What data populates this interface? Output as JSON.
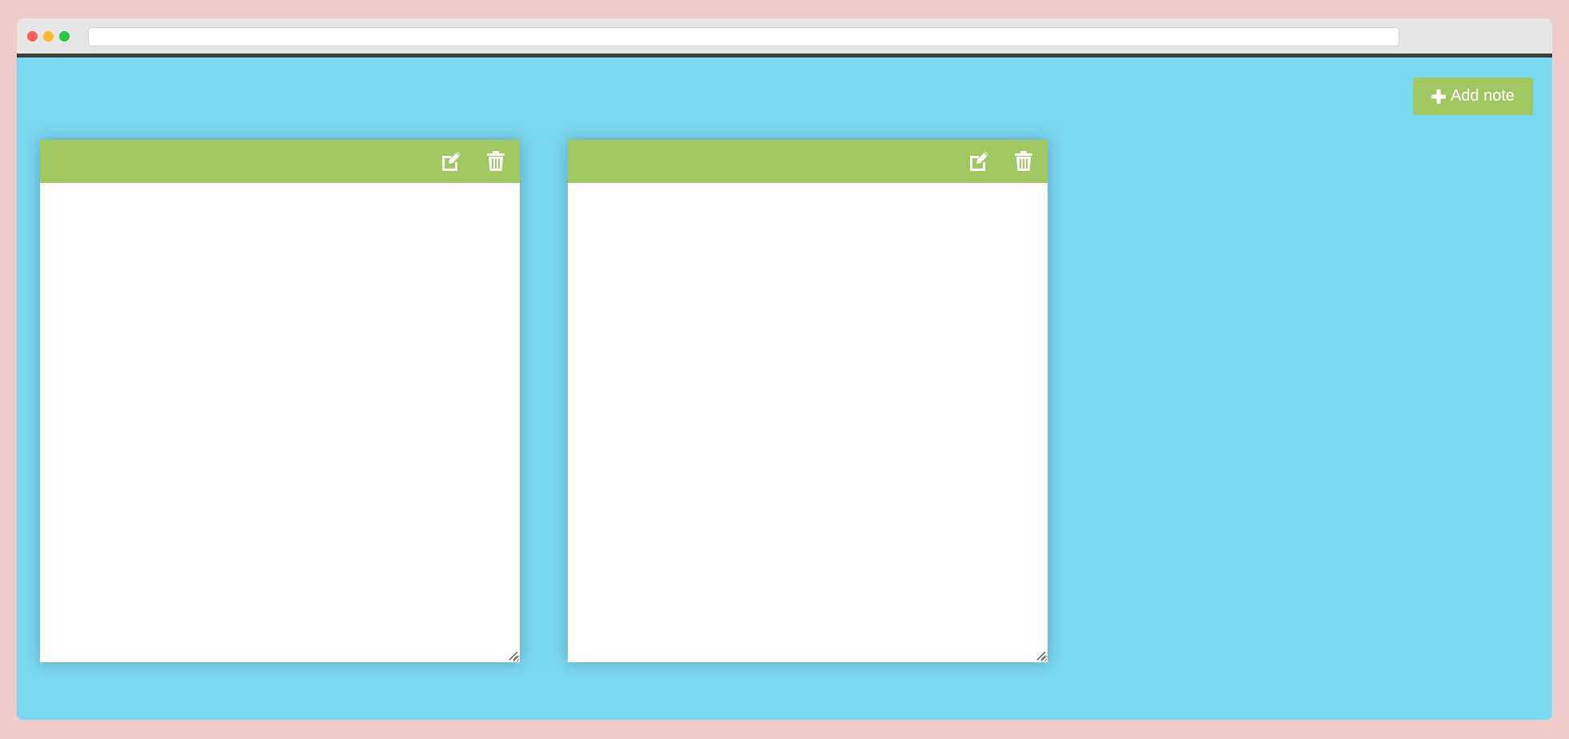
{
  "browser": {
    "address_value": ""
  },
  "toolbar": {
    "add_note_label": "Add note"
  },
  "notes": [
    {
      "text": ""
    },
    {
      "text": ""
    }
  ],
  "colors": {
    "page_background": "#f0cbcc",
    "app_background": "#7bd8f1",
    "accent_green": "#9fc862",
    "note_body": "#ffffff"
  },
  "icons": {
    "add": "plus-icon",
    "edit": "edit-icon",
    "delete": "trash-icon"
  }
}
